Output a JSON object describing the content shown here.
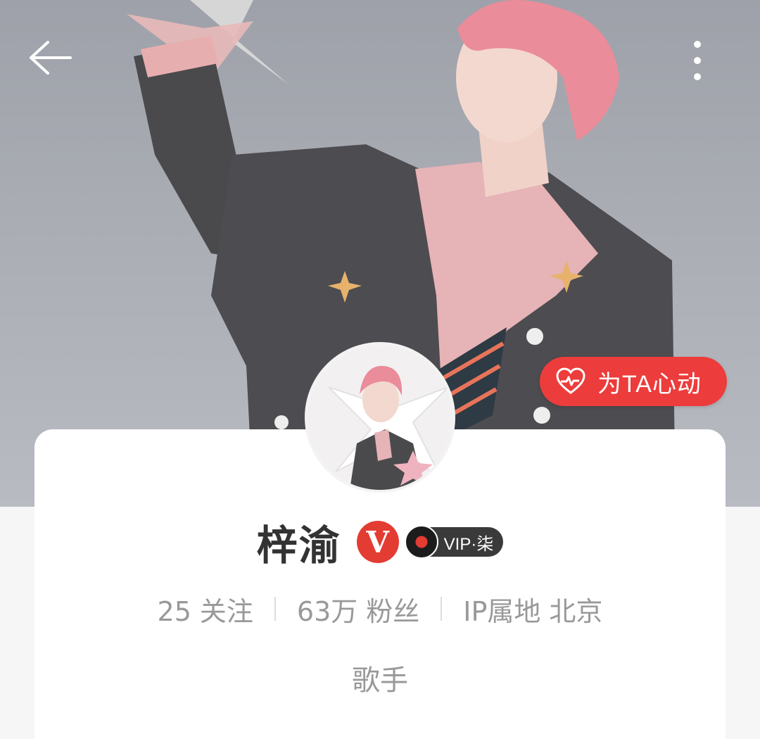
{
  "header": {
    "back_icon": "arrow-left-icon",
    "more_icon": "more-vertical-icon"
  },
  "like_button": {
    "label": "为TA心动",
    "icon": "heart-pulse-icon",
    "color": "#ec3c3b"
  },
  "profile": {
    "name": "梓渝",
    "verified_badge": "V",
    "verified_color": "#e33c33",
    "vip_label": "VIP·柒"
  },
  "stats": [
    {
      "value": "25",
      "label": "关注"
    },
    {
      "value": "63万",
      "label": "粉丝"
    },
    {
      "value": "IP属地",
      "label": "北京"
    }
  ],
  "role": "歌手"
}
